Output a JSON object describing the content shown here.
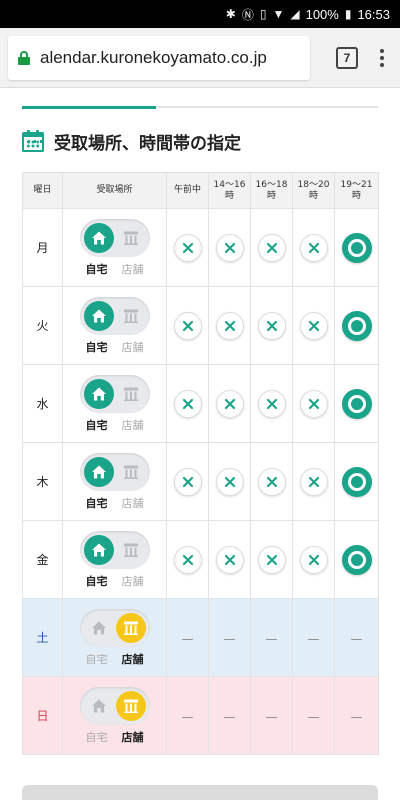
{
  "status_bar": {
    "battery": "100%",
    "time": "16:53"
  },
  "browser": {
    "url": "alendar.kuronekoyamato.co.jp",
    "tab_count": "7"
  },
  "section": {
    "title": "受取場所、時間帯の指定"
  },
  "table": {
    "headers": {
      "day": "曜日",
      "place": "受取場所",
      "slot_morning": "午前中",
      "slot_14_16": "14〜16時",
      "slot_16_18": "16〜18時",
      "slot_18_20": "18〜20時",
      "slot_19_21": "19〜21時"
    },
    "place_labels": {
      "home": "自宅",
      "store": "店舗"
    },
    "rows": [
      {
        "day": "月",
        "place": "home",
        "slots": [
          "unavailable",
          "unavailable",
          "unavailable",
          "unavailable",
          "selected"
        ]
      },
      {
        "day": "火",
        "place": "home",
        "slots": [
          "unavailable",
          "unavailable",
          "unavailable",
          "unavailable",
          "selected"
        ]
      },
      {
        "day": "水",
        "place": "home",
        "slots": [
          "unavailable",
          "unavailable",
          "unavailable",
          "unavailable",
          "selected"
        ]
      },
      {
        "day": "木",
        "place": "home",
        "slots": [
          "unavailable",
          "unavailable",
          "unavailable",
          "unavailable",
          "selected"
        ]
      },
      {
        "day": "金",
        "place": "home",
        "slots": [
          "unavailable",
          "unavailable",
          "unavailable",
          "unavailable",
          "selected"
        ]
      },
      {
        "day": "土",
        "place": "store",
        "slots": [
          "—",
          "—",
          "—",
          "—",
          "—"
        ]
      },
      {
        "day": "日",
        "place": "store",
        "slots": [
          "—",
          "—",
          "—",
          "—",
          "—"
        ]
      }
    ]
  },
  "colors": {
    "accent": "#1aa48a",
    "store": "#f6c618",
    "saturday_bg": "#e1eef8",
    "sunday_bg": "#fbe3e7",
    "saturday_text": "#2b56a6",
    "sunday_text": "#d13a4b"
  }
}
